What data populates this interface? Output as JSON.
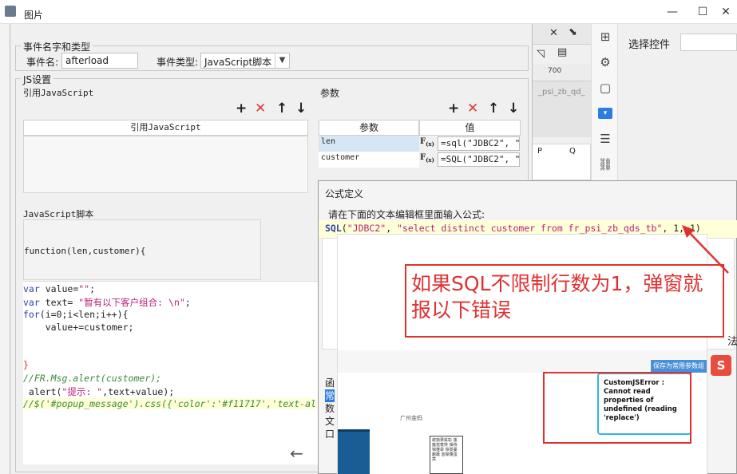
{
  "window": {
    "title": "图片",
    "minimize": "—",
    "maximize": "☐",
    "close": "✕"
  },
  "background": {
    "ruler_label": "700",
    "cell_name": "_psi_zb_qd_",
    "col_p": "P",
    "col_q": "Q",
    "select_label": "选择控件"
  },
  "event_dialog": {
    "group_name_type": "事件名字和类型",
    "event_name_label": "事件名:",
    "event_name_value": "afterload",
    "event_type_label": "事件类型:",
    "event_type_value": "JavaScript脚本",
    "group_js": "JS设置",
    "ref_js_label": "引用JavaScript",
    "ref_js_header": "引用JavaScript",
    "params_label": "参数",
    "params_col_name": "参数",
    "params_col_value": "值",
    "params": [
      {
        "name": "len",
        "value": "=sql(\"JDBC2\", \"w"
      },
      {
        "name": "customer",
        "value": "=SQL(\"JDBC2\", \"s"
      }
    ],
    "script_label": "JavaScript脚本",
    "function_sig": "function(len,customer){",
    "tools": {
      "add": "+",
      "delete": "✕",
      "up": "↑",
      "down": "↓"
    },
    "nav_back": "←",
    "nav_forward": "→"
  },
  "code": {
    "l1_kw": "var",
    "l1_rest": " value=",
    "l1_str": "\"\"",
    "l1_end": ";",
    "l2_kw": "var",
    "l2_rest": " text= ",
    "l2_str": "\"暂有以下客户组合: \\n\"",
    "l2_end": ";",
    "l3_kw": "for",
    "l3_rest": "(i=0;i<len;i++){",
    "l4": "    value+=customer;",
    "l5": "}",
    "l6": "//FR.Msg.alert(customer);",
    "l7_a": " alert(",
    "l7_str": "\"提示: \"",
    "l7_b": ",text+value);",
    "l8": "//$('#popup_message').css({'color':'#f11717','text-al"
  },
  "formula_dialog": {
    "title": "公式定义",
    "prompt": "请在下面的文本编辑框里面输入公式:",
    "fn": "SQL",
    "open": "(",
    "arg1": "\"JDBC2\"",
    "sep1": ", ",
    "arg2": "\"select distinct customer from fr_psi_zb_qds_tb\"",
    "rest": ", 1, 1)",
    "side_letters": [
      "函",
      "常",
      "数",
      "文",
      "口"
    ],
    "side_right": "法"
  },
  "overlay": {
    "save_button": "保存为常用参数组合",
    "logo": "广州金蚂",
    "stamp_text": "缤茹果蚨彰 莲蔟悦蓑馋 辑侍锦蓬牮 铁晏蔓蒯蘸 蓝晰蔑蛋蒿",
    "error_text": "CustomJSError : Cannot read properties of undefined (reading 'replace')"
  },
  "annotation": {
    "text": "如果SQL不限制行数为1，弹窗就报以下错误"
  },
  "ime": "S"
}
